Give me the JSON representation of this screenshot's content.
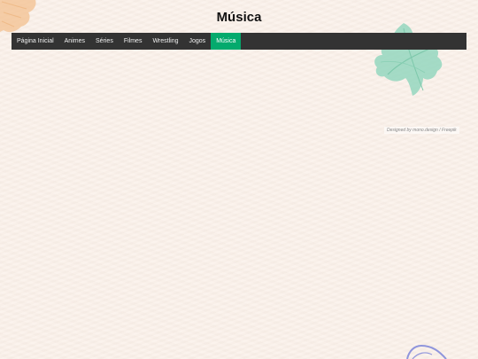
{
  "page": {
    "title": "Música"
  },
  "nav": {
    "items": [
      {
        "label": "Página Inicial",
        "active": false
      },
      {
        "label": "Animes",
        "active": false
      },
      {
        "label": "Séries",
        "active": false
      },
      {
        "label": "Filmes",
        "active": false
      },
      {
        "label": "Wrestling",
        "active": false
      },
      {
        "label": "Jogos",
        "active": false
      },
      {
        "label": "Música",
        "active": true
      }
    ],
    "colors": {
      "bar": "#333333",
      "active": "#04aa6d",
      "text": "#f2f2f2"
    }
  },
  "credit": {
    "text": "Designed by mono.design / Freepik"
  },
  "decorations": {
    "top_left": "orange-leaf-icon",
    "top_right": "green-leaf-icon",
    "bottom_right": "blue-leaf-outline-icon"
  }
}
